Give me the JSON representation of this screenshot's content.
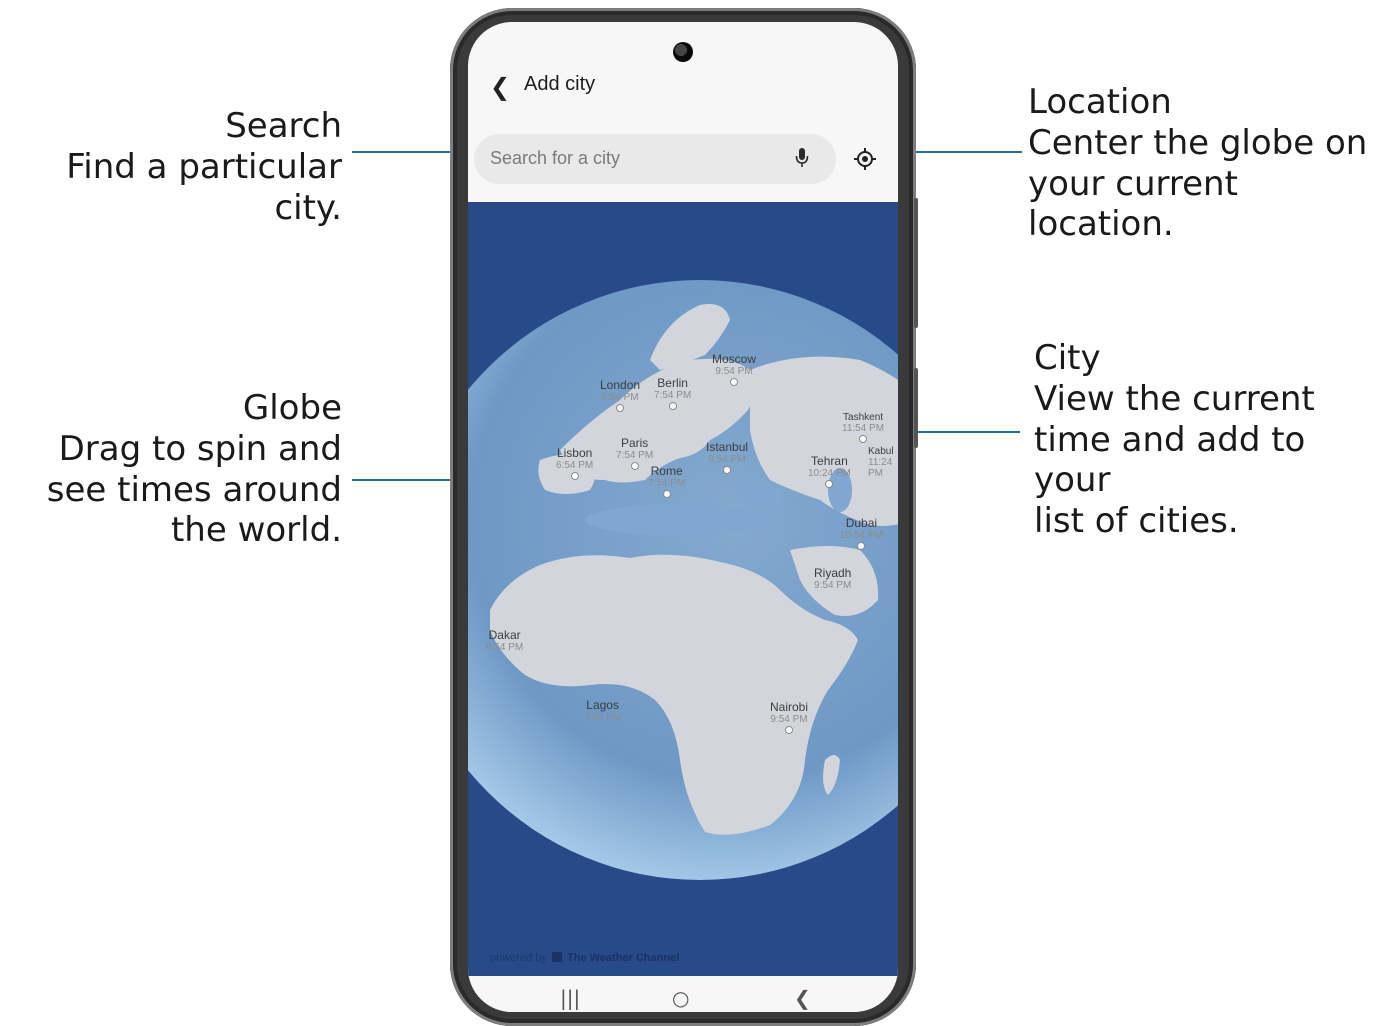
{
  "app": {
    "title": "Add city",
    "search_placeholder": "Search for a city"
  },
  "callouts": {
    "search": {
      "title": "Search",
      "desc": "Find a particular city."
    },
    "location": {
      "title": "Location",
      "desc_line1": "Center the globe on",
      "desc_line2": "your current location."
    },
    "globe": {
      "title": "Globe",
      "desc_line1": "Drag to spin and",
      "desc_line2": "see times around",
      "desc_line3": "the world."
    },
    "city": {
      "title": "City",
      "desc_line1": "View the current",
      "desc_line2": "time and add to your",
      "desc_line3": "list of cities."
    }
  },
  "cities": [
    {
      "name": "Moscow",
      "time": "9:54 PM"
    },
    {
      "name": "London",
      "time": "6:54 PM"
    },
    {
      "name": "Berlin",
      "time": "7:54 PM"
    },
    {
      "name": "Paris",
      "time": "7:54 PM"
    },
    {
      "name": "Lisbon",
      "time": "6:54 PM"
    },
    {
      "name": "Istanbul",
      "time": "9:54 PM"
    },
    {
      "name": "Rome",
      "time": "7:54 PM"
    },
    {
      "name": "Tashkent",
      "time": "11:54 PM"
    },
    {
      "name": "Kabul",
      "time": "11:24 PM"
    },
    {
      "name": "Tehran",
      "time": "10:24 PM"
    },
    {
      "name": "Dubai",
      "time": "10:54 PM"
    },
    {
      "name": "Riyadh",
      "time": "9:54 PM"
    },
    {
      "name": "Dakar",
      "time": "6:54 PM"
    },
    {
      "name": "Lagos",
      "time": "7:54 PM"
    },
    {
      "name": "Nairobi",
      "time": "9:54 PM"
    }
  ],
  "footer": {
    "powered_by": "powered by",
    "brand": "The Weather Channel"
  },
  "colors": {
    "ocean": "#284a88",
    "globe_water": "#7fa7cf",
    "land": "#d2d6dc",
    "leader": "#1f6fa3"
  },
  "icons": {
    "back": "chevron-left-icon",
    "mic": "microphone-icon",
    "location": "target-location-icon"
  }
}
